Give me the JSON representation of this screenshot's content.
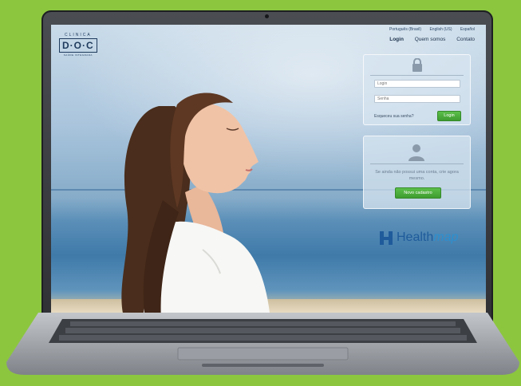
{
  "site": {
    "logo": {
      "top": "CLINICA",
      "name": "D·O·C",
      "sub": "SAÚDE INTEGRADA"
    },
    "languages": [
      "Português (Brasil)",
      "English (US)",
      "Español"
    ],
    "nav": [
      "Login",
      "Quem somos",
      "Contato"
    ]
  },
  "login": {
    "login_placeholder": "Login",
    "password_placeholder": "Senha",
    "forgot": "Esqueceu sua senha?",
    "button": "Login"
  },
  "register": {
    "text": "Se ainda não possui uma conta, crie agora mesmo.",
    "button": "Novo cadastro"
  },
  "brand": {
    "health": "Health",
    "map": "map"
  },
  "colors": {
    "background": "#8cc63f",
    "accent_green": "#4aac3a",
    "brand_blue": "#1f5b9b"
  }
}
